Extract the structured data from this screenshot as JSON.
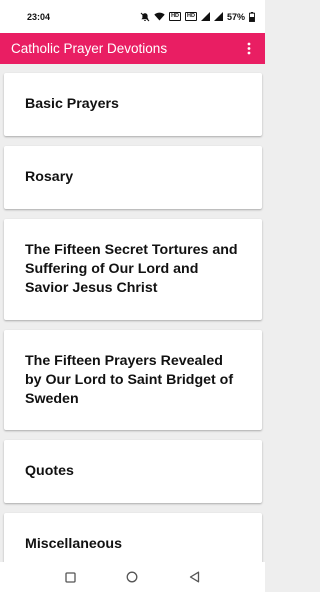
{
  "status_bar": {
    "time": "23:04",
    "battery_percent": "57%",
    "icons": [
      "mute-icon",
      "wifi-icon",
      "volte-icon",
      "volte-icon",
      "signal-icon",
      "signal-icon",
      "battery-icon"
    ],
    "volte_label_1": "HD",
    "volte_label_2": "HD"
  },
  "app_bar": {
    "title": "Catholic Prayer Devotions",
    "color": "#e91e63",
    "menu_icon": "more-vert-icon"
  },
  "menu": {
    "items": [
      {
        "label": "Basic Prayers"
      },
      {
        "label": "Rosary"
      },
      {
        "label": "The Fifteen Secret Tortures and Suffering of Our Lord and Savior Jesus Christ"
      },
      {
        "label": "The Fifteen Prayers Revealed by Our Lord to Saint Bridget of Sweden"
      },
      {
        "label": "Quotes"
      },
      {
        "label": "Miscellaneous"
      }
    ]
  },
  "nav_bar": {
    "icons": [
      "recents-square-icon",
      "home-circle-icon",
      "back-triangle-icon"
    ]
  }
}
